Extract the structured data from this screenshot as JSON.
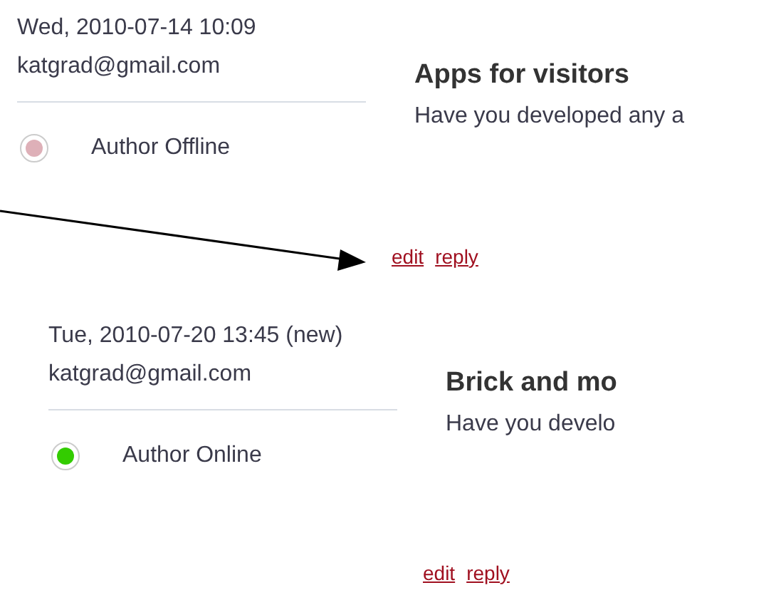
{
  "comments": [
    {
      "date": "Wed, 2010-07-14 10:09",
      "author": "katgrad@gmail.com",
      "status": "Author Offline",
      "online": false,
      "title": "Apps for visitors",
      "body": "Have you developed any a",
      "links": [
        "edit",
        "reply"
      ],
      "children": [
        {
          "date": "Tue, 2010-07-20 13:45 (new)",
          "author": "katgrad@gmail.com",
          "status": "Author Online",
          "online": true,
          "title": "Brick and mo",
          "body": "Have you develo",
          "links": [
            "edit",
            "reply"
          ]
        }
      ]
    }
  ]
}
